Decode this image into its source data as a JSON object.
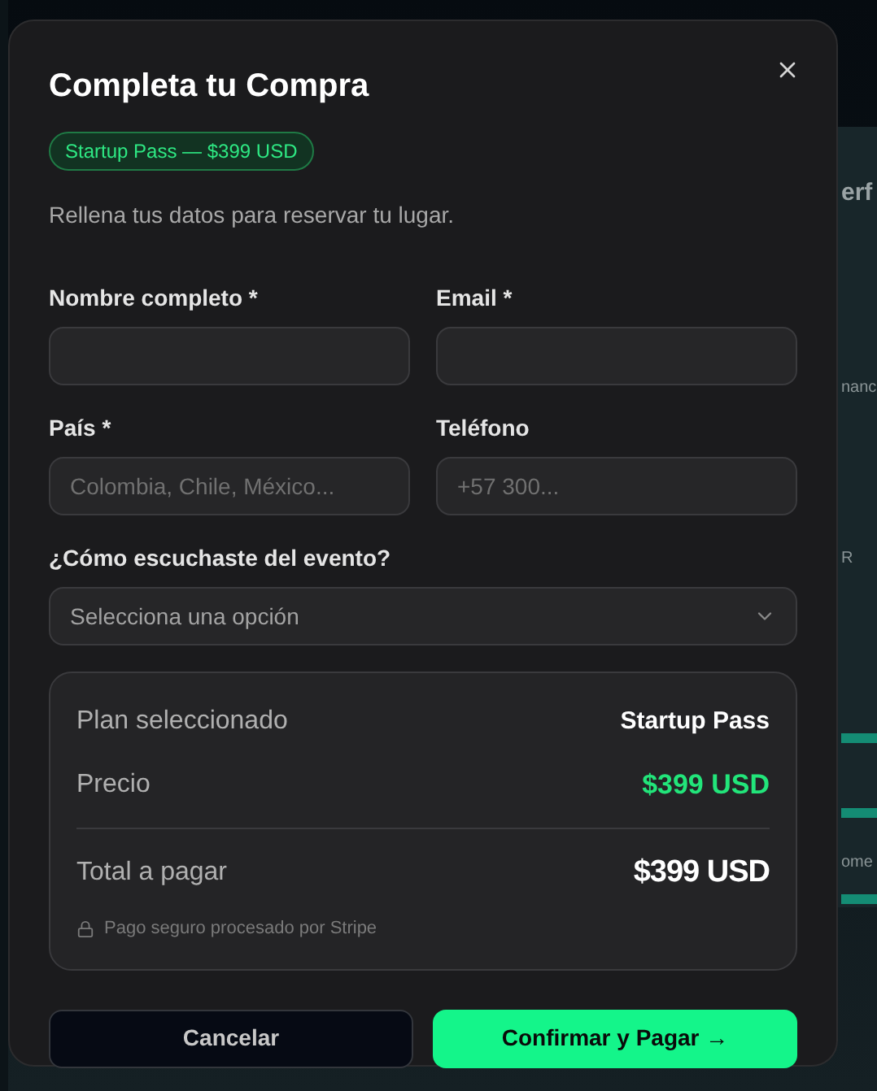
{
  "background": {
    "fragments": [
      "erf",
      "nanc",
      "R",
      "ome"
    ]
  },
  "dialog": {
    "title": "Completa tu Compra",
    "badge": "Startup Pass — $399 USD",
    "subtitle": "Rellena tus datos para reservar tu lugar.",
    "fields": [
      {
        "kind": "text",
        "label": "Nombre completo *"
      },
      {
        "kind": "text",
        "label": "Email *"
      },
      {
        "kind": "text",
        "label": "País *",
        "placeholder": "Colombia, Chile, México..."
      },
      {
        "kind": "text",
        "label": "Teléfono",
        "placeholder": "+57 300..."
      },
      {
        "kind": "select",
        "label": "¿Cómo escuchaste del evento?",
        "placeholder": "Selecciona una opción"
      }
    ],
    "summary": {
      "rows": [
        {
          "kind": "plain",
          "label": "Plan seleccionado",
          "value": "Startup Pass"
        },
        {
          "kind": "accent",
          "label": "Precio",
          "value": "$399 USD"
        },
        {
          "kind": "total",
          "label": "Total a pagar",
          "value": "$399 USD"
        }
      ],
      "note": "Pago seguro procesado por Stripe"
    },
    "buttons": [
      {
        "kind": "secondary",
        "label": "Cancelar"
      },
      {
        "kind": "primary",
        "label": "Confirmar y Pagar →"
      }
    ]
  }
}
